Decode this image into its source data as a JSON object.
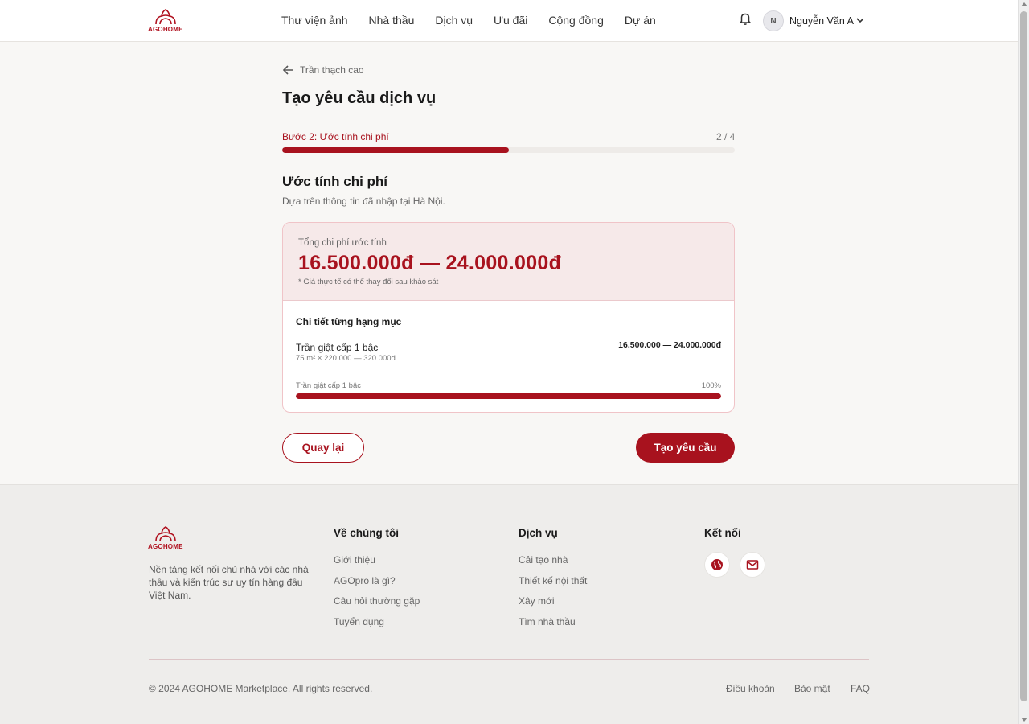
{
  "header": {
    "logo_text": "AGOHOME",
    "nav": [
      "Thư viện ảnh",
      "Nhà thầu",
      "Dịch vụ",
      "Ưu đãi",
      "Cộng đồng",
      "Dự án"
    ],
    "user": {
      "initial": "N",
      "name": "Nguyễn Văn A"
    }
  },
  "main": {
    "back_label": "Trần thạch cao",
    "page_title": "Tạo yêu cầu dịch vụ",
    "step": {
      "label": "Bước 2: Ước tính chi phí",
      "count": "2 / 4",
      "progress": 0.5
    },
    "section_title": "Ước tính chi phí",
    "section_sub": "Dựa trên thông tin đã nhập tại Hà Nội.",
    "estimate": {
      "total_label": "Tổng chi phí ước tính",
      "total_value": "16.500.000đ — 24.000.000đ",
      "note": "* Giá thực tế có thể thay đổi sau khảo sát",
      "detail_title": "Chi tiết từng hạng mục",
      "item": {
        "name": "Trần giật cấp 1 bậc",
        "formula": "75 m² × 220.000 — 320.000đ",
        "price": "16.500.000 — 24.000.000đ",
        "bar_label": "Trần giật cấp 1 bậc",
        "bar_pct": "100%",
        "share": 1.0
      }
    },
    "buttons": {
      "back": "Quay lại",
      "create": "Tạo yêu cầu"
    }
  },
  "footer": {
    "logo_text": "AGOHOME",
    "desc": "Nền tảng kết nối chủ nhà với các nhà thầu và kiến trúc sư uy tín hàng đầu Việt Nam.",
    "about": {
      "title": "Về chúng tôi",
      "links": [
        "Giới thiệu",
        "AGOpro là gì?",
        "Câu hỏi thường gặp",
        "Tuyển dụng"
      ]
    },
    "services": {
      "title": "Dịch vụ",
      "links": [
        "Cải tạo nhà",
        "Thiết kế nội thất",
        "Xây mới",
        "Tìm nhà thầu"
      ]
    },
    "connect": {
      "title": "Kết nối",
      "icons": [
        "globe-icon",
        "mail-icon"
      ]
    },
    "copyright": "© 2024 AGOHOME Marketplace. All rights reserved.",
    "legal": [
      "Điều khoản",
      "Bảo mật",
      "FAQ"
    ]
  },
  "colors": {
    "brand": "#a8121e",
    "card_bg": "#f6e9e9",
    "page_bg": "#f8f7f5",
    "footer_bg": "#eeedeb"
  }
}
